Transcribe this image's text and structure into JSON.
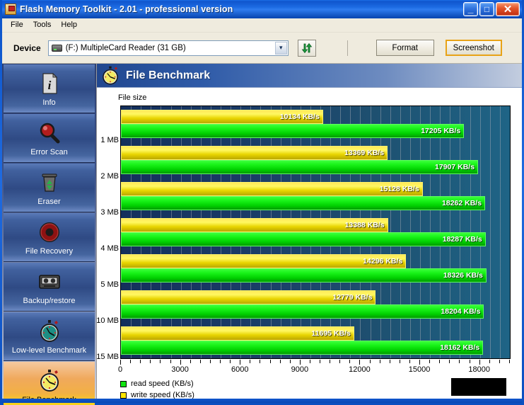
{
  "window": {
    "title": "Flash Memory Toolkit - 2.01 - professional version",
    "app_icon": "flash-drive-icon",
    "minimize_glyph": "_",
    "maximize_glyph": "□",
    "close_glyph": "✕"
  },
  "menubar": {
    "items": [
      {
        "label": "File"
      },
      {
        "label": "Tools"
      },
      {
        "label": "Help"
      }
    ]
  },
  "toolbar": {
    "device_label": "Device",
    "device_value": "(F:) MultipleCard  Reader (31 GB)",
    "combo_arrow": "▾",
    "refresh_icon": "refresh-arrows-icon",
    "format_label": "Format",
    "screenshot_label": "Screenshot"
  },
  "sidebar": {
    "items": [
      {
        "label": "Info",
        "icon": "info-document-icon",
        "selected": false
      },
      {
        "label": "Error Scan",
        "icon": "magnifier-icon",
        "selected": false
      },
      {
        "label": "Eraser",
        "icon": "trash-bin-icon",
        "selected": false
      },
      {
        "label": "File Recovery",
        "icon": "lifebuoy-icon",
        "selected": false
      },
      {
        "label": "Backup/restore",
        "icon": "tape-cassette-icon",
        "selected": false
      },
      {
        "label": "Low-level Benchmark",
        "icon": "stopwatch-teal-icon",
        "selected": false
      },
      {
        "label": "File Benchmark",
        "icon": "stopwatch-yellow-icon",
        "selected": true
      }
    ]
  },
  "panel": {
    "title": "File Benchmark",
    "icon": "stopwatch-yellow-icon"
  },
  "chart_data": {
    "type": "bar",
    "orientation": "horizontal",
    "title": "File Benchmark",
    "xlabel": "",
    "ylabel": "File size",
    "categories": [
      "1 MB",
      "2 MB",
      "3 MB",
      "4 MB",
      "5 MB",
      "10 MB",
      "15 MB"
    ],
    "series": [
      {
        "name": "write speed (KB/s)",
        "color": "#ffe800",
        "values": [
          10134,
          13369,
          15128,
          13388,
          14296,
          12779,
          11695
        ],
        "labels": [
          "10134 KB/s",
          "13369 KB/s",
          "15128 KB/s",
          "13388 KB/s",
          "14296 KB/s",
          "12779 KB/s",
          "11695 KB/s"
        ]
      },
      {
        "name": "read speed (KB/s)",
        "color": "#12e512",
        "values": [
          17205,
          17907,
          18262,
          18287,
          18326,
          18204,
          18162
        ],
        "labels": [
          "17205 KB/s",
          "17907 KB/s",
          "18262 KB/s",
          "18287 KB/s",
          "18326 KB/s",
          "18204 KB/s",
          "18162 KB/s"
        ]
      }
    ],
    "xticks": [
      0,
      3000,
      6000,
      9000,
      12000,
      15000,
      18000
    ],
    "xticklabels": [
      "0",
      "3000",
      "6000",
      "9000",
      "12000",
      "15000",
      "18000"
    ],
    "xlim": [
      0,
      19500
    ],
    "grid": true,
    "legend": [
      "read speed (KB/s)",
      "write speed (KB/s)"
    ],
    "legend_position": "bottom-left",
    "plot_background": "#1a3a66"
  },
  "legend": {
    "read": {
      "label": "read speed (KB/s)",
      "color": "#12e512"
    },
    "write": {
      "label": "write speed (KB/s)",
      "color": "#ffe800"
    }
  }
}
